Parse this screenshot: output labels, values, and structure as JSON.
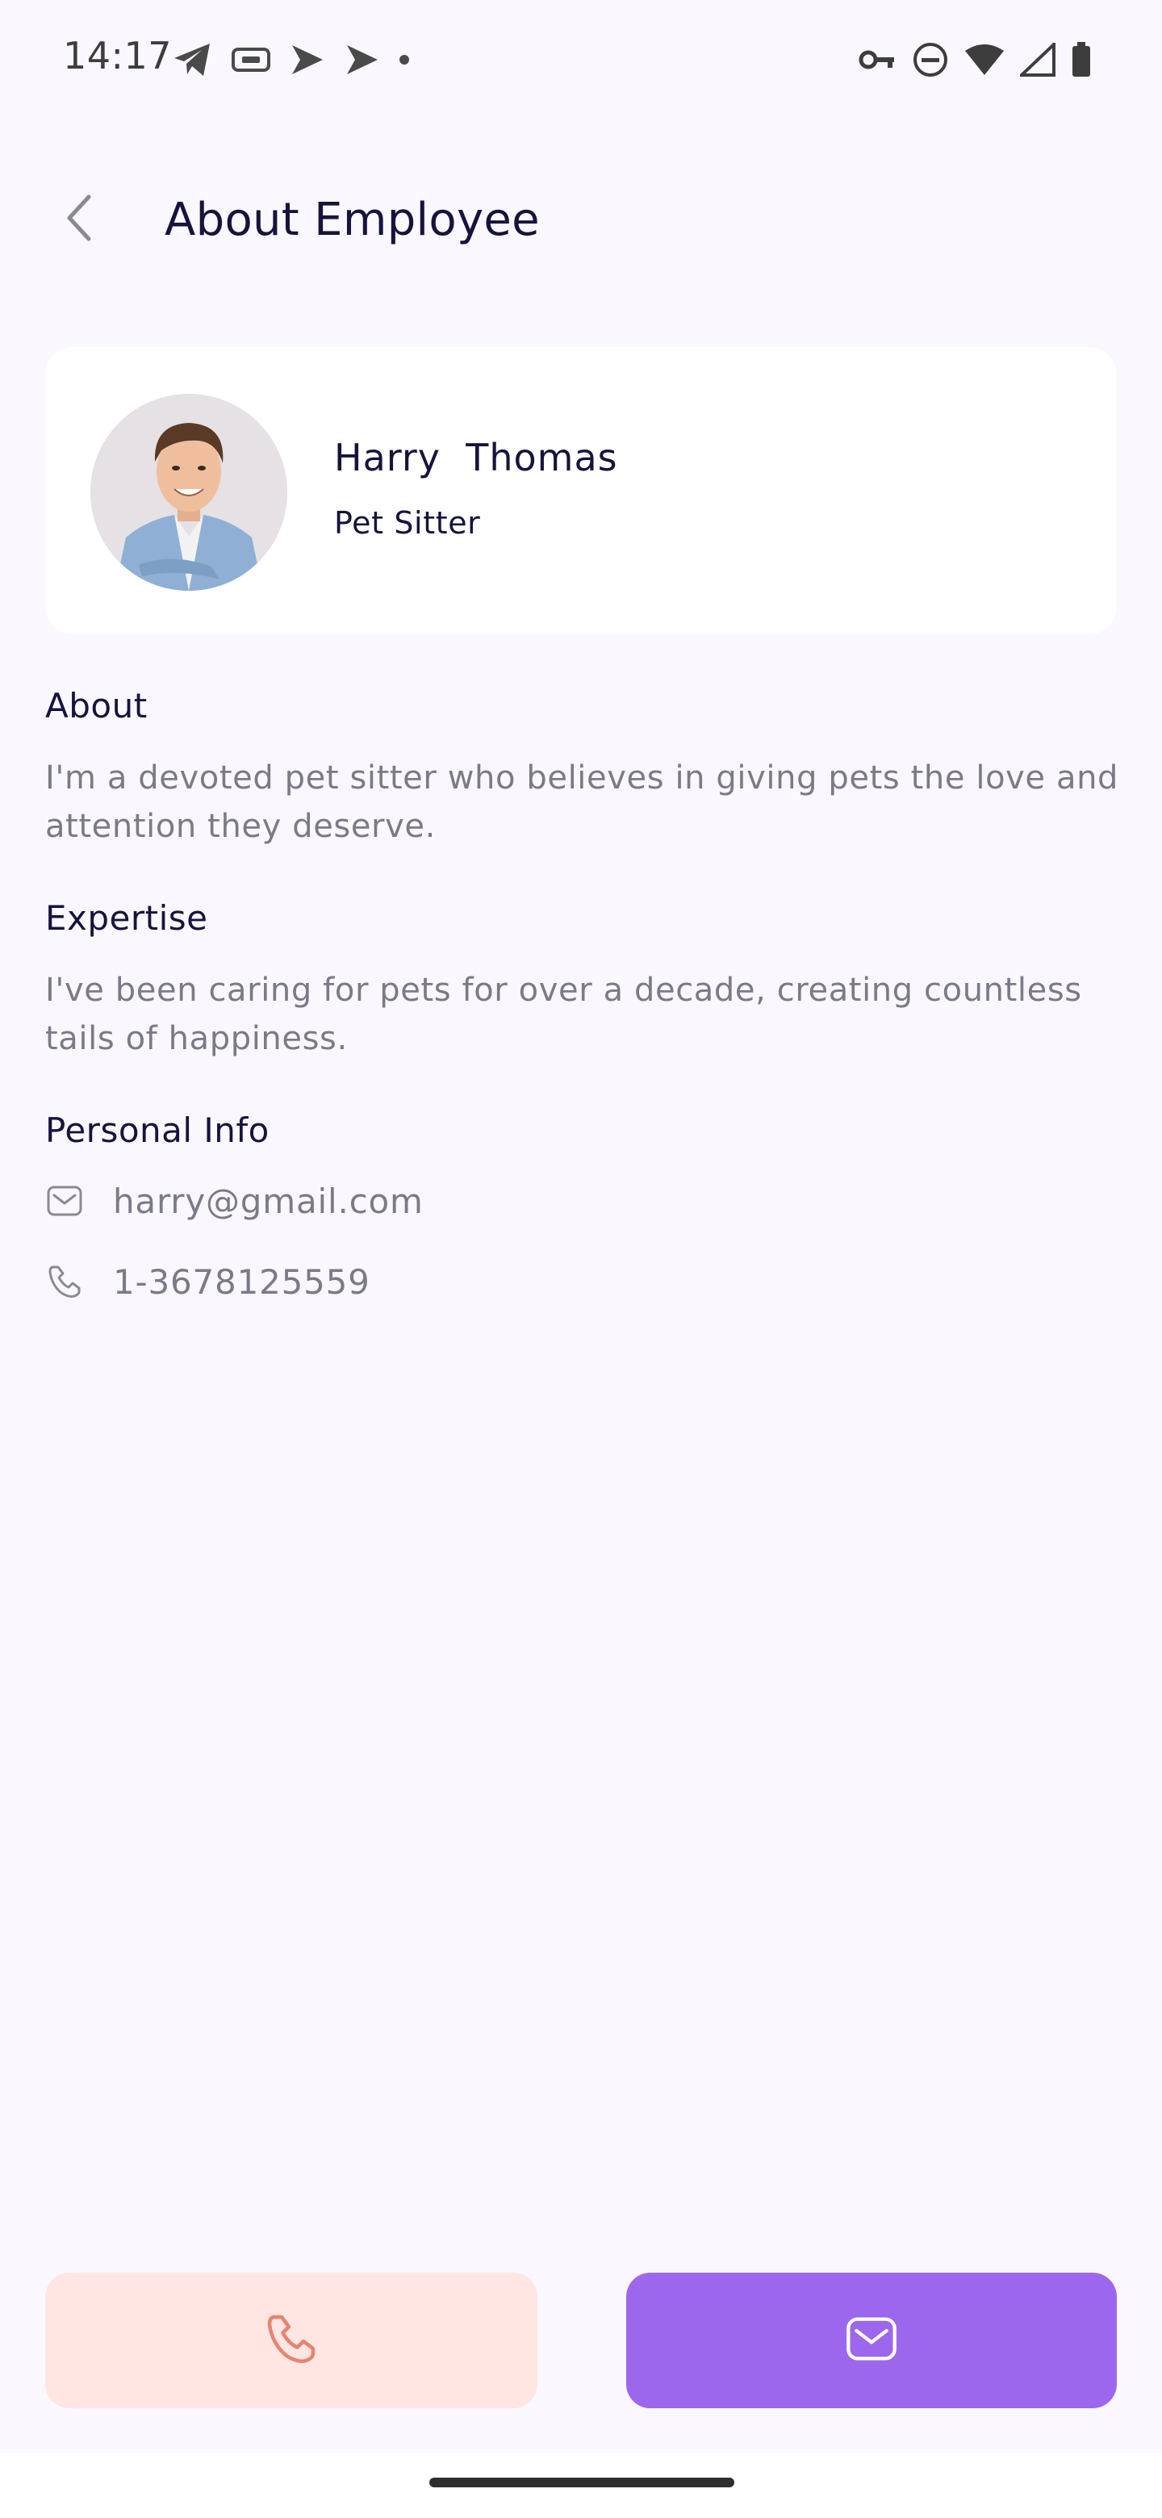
{
  "status_bar": {
    "time": "14:17",
    "left_icons": [
      "telegram-icon",
      "vpn-badge-icon",
      "play-store-icon",
      "play-store-icon",
      "dot-icon"
    ],
    "right_icons": [
      "key-icon",
      "do-not-disturb-icon",
      "wifi-icon",
      "cell-signal-icon",
      "battery-icon"
    ]
  },
  "header": {
    "title": "About Employee",
    "back_icon": "chevron-left-icon"
  },
  "profile": {
    "name": "Harry  Thomas",
    "role": "Pet Sitter",
    "avatar_icon": "person-photo"
  },
  "about": {
    "heading": "About",
    "text": "I'm a devoted pet sitter who believes in giving pets the love and attention they deserve."
  },
  "expertise": {
    "heading": "Expertise",
    "text": "I've been caring for pets for over a decade, creating countless tails of happiness."
  },
  "personal_info": {
    "heading": "Personal Info",
    "email": "harry@gmail.com",
    "phone": "1-3678125559",
    "email_icon": "mail-icon",
    "phone_icon": "phone-icon"
  },
  "actions": {
    "call_icon": "phone-icon",
    "message_icon": "mail-icon"
  },
  "colors": {
    "background": "#fbf7fe",
    "accent": "#9c67ec",
    "call_button_bg": "#ffe6e3",
    "call_icon": "#e8836f",
    "title": "#16143d",
    "muted_text": "#7b7a88"
  }
}
